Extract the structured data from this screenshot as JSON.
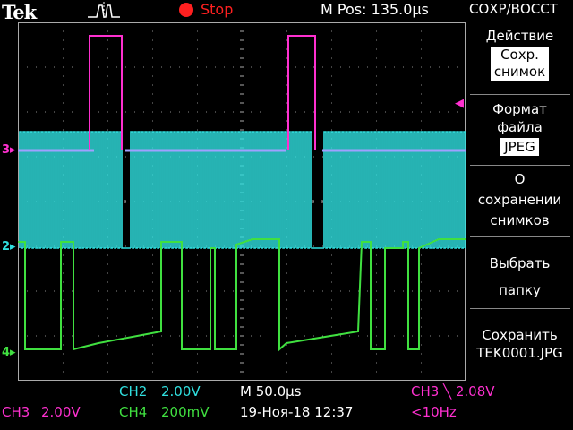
{
  "header": {
    "brand": "Tek",
    "run_state": "Stop",
    "horizontal_position": "M Pos: 135.0µs",
    "menu_title": "СОХР/ВОССТ"
  },
  "side_menu": {
    "action_label": "Действие",
    "action_value_line1": "Сохр.",
    "action_value_line2": "снимок",
    "format_line1": "Формат",
    "format_line2": "файла",
    "format_value": "JPEG",
    "about_line1": "О",
    "about_line2": "сохранении",
    "about_line3": "снимков",
    "folder_line1": "Выбрать",
    "folder_line2": "папку",
    "save_line1": "Сохранить",
    "save_line2": "TEK0001.JPG"
  },
  "channel_markers": {
    "ch3": "3",
    "ch2": "2",
    "ch4": "4"
  },
  "status": {
    "ch2_label": "CH2",
    "ch2_scale": "2.00V",
    "ch3_label": "CH3",
    "ch3_scale": "2.00V",
    "ch4_label": "CH4",
    "ch4_scale": "200mV",
    "timebase": "M 50.0µs",
    "datetime": "19-Ноя-18 12:37",
    "trigger": "CH3 ╲ 2.08V",
    "trigger_freq": "<10Hz"
  },
  "colors": {
    "ch2": "#30e0e0",
    "ch3": "#ff30d0",
    "ch4": "#40e040",
    "trigger_ref": "#a0a0ff"
  }
}
